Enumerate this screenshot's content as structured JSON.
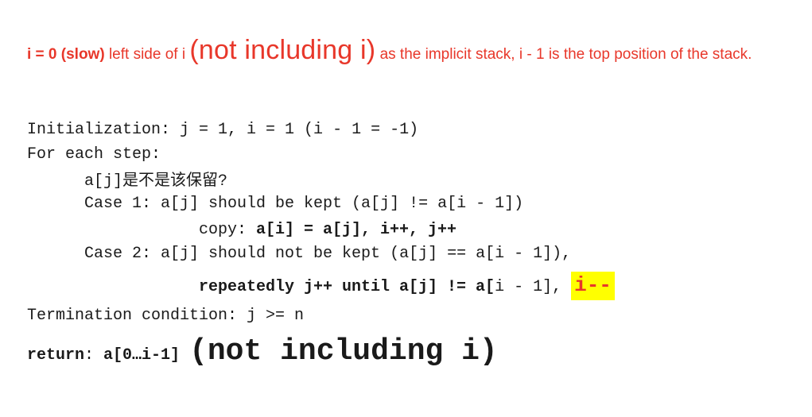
{
  "header": {
    "part1": "i = 0 (slow)",
    "part2": " left side of i ",
    "part3": "(not including i)",
    "part4": " as the implicit stack, i - 1 is the top position of the stack."
  },
  "code": {
    "init": "Initialization: j = 1, i = 1 (i - 1 = -1)",
    "for_each": "For each step:",
    "question_code": "a[j]",
    "question_cjk": "是不是该保留",
    "question_mark": "?",
    "case1": "Case 1: a[j] should be kept (a[j] != a[i - 1])",
    "copy_label": "copy: ",
    "copy_code": "a[i] = a[j], i++, j++",
    "case2": "Case 2: a[j] should not be kept (a[j] == a[i - 1]),",
    "repeat_bold": "repeatedly j++ until a[j] != a[",
    "repeat_plain": "i - 1",
    "repeat_end": "], ",
    "decrement": "i--",
    "termination": "Termination condition: j >= n",
    "return_label": "return",
    "return_colon": ": ",
    "return_value": "a[0…i-1]",
    "return_note": "(not including i)"
  },
  "colors": {
    "accent_red": "#e8372a",
    "highlight": "#ffff00",
    "text": "#1a1a1a"
  }
}
